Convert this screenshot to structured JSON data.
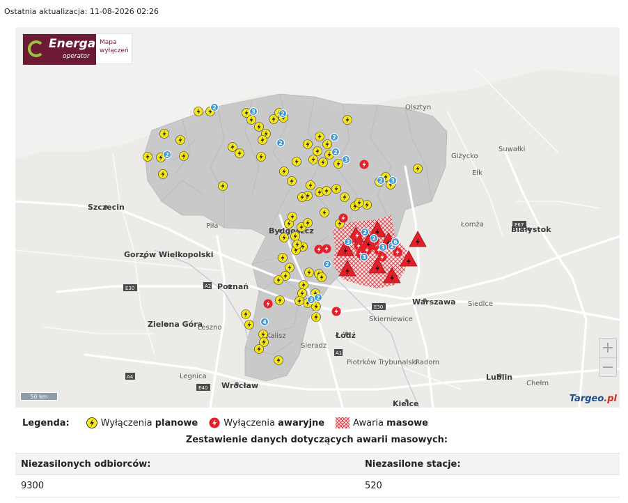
{
  "header": {
    "update_label": "Ostatnia aktualizacja:",
    "update_value": "11-08-2026 02:26"
  },
  "logo": {
    "brand": "Energa",
    "brand_sub": "operator",
    "title_line1": "Mapa",
    "title_line2": "wyłączeń"
  },
  "map": {
    "scale_label": "50 km",
    "attribution": "Targeo",
    "attribution_suffix": ".pl",
    "zoom_in": "+",
    "zoom_out": "−",
    "cities": [
      {
        "name": "Szczecin",
        "bold": true
      },
      {
        "name": "Bydgoszcz",
        "bold": true
      },
      {
        "name": "Poznań",
        "bold": true
      },
      {
        "name": "Zielona Góra",
        "bold": true
      },
      {
        "name": "Gorzów Wielkopolski",
        "bold": true
      },
      {
        "name": "Łódź",
        "bold": true
      },
      {
        "name": "Warszawa",
        "bold": true
      },
      {
        "name": "Białystok",
        "bold": true
      },
      {
        "name": "Lublin",
        "bold": true
      },
      {
        "name": "Kielce",
        "bold": true
      },
      {
        "name": "Wrocław",
        "bold": true
      },
      {
        "name": "Radom",
        "bold": false
      },
      {
        "name": "Olsztyn",
        "bold": false
      },
      {
        "name": "Łomża",
        "bold": false
      },
      {
        "name": "Siedlce",
        "bold": false
      },
      {
        "name": "Legnica",
        "bold": false
      },
      {
        "name": "Piła",
        "bold": false
      },
      {
        "name": "Suwałki",
        "bold": false
      },
      {
        "name": "Ełk",
        "bold": false
      },
      {
        "name": "Giżycko",
        "bold": false
      },
      {
        "name": "Chełm",
        "bold": false
      },
      {
        "name": "Leszno",
        "bold": false
      },
      {
        "name": "Sieradz",
        "bold": false
      },
      {
        "name": "Skierniewice",
        "bold": false
      },
      {
        "name": "Piotrków Trybunalski",
        "bold": false
      },
      {
        "name": "Kalisz",
        "bold": false
      }
    ],
    "marker_counts": {
      "planned": 78,
      "emergency": 14,
      "mass": 9,
      "clusters": [
        "2",
        "3",
        "2",
        "2",
        "2",
        "2",
        "3",
        "2",
        "3",
        "2",
        "4",
        "3",
        "3",
        "2",
        "2",
        "2",
        "3",
        "6",
        "2",
        "3",
        "2"
      ]
    }
  },
  "legend": {
    "title": "Legenda:",
    "planned_prefix": "Wyłączenia",
    "planned_bold": "planowe",
    "emergency_prefix": "Wyłączenia",
    "emergency_bold": "awaryjne",
    "mass_prefix": "Awaria",
    "mass_bold": "masowe",
    "colors": {
      "planned": "#f6e51b",
      "emergency": "#e3202a",
      "mass": "#e3202a",
      "cluster": "#3d97d3"
    }
  },
  "summary": {
    "title": "Zestawienie danych dotyczących awarii masowych:",
    "columns": [
      "Niezasilonych odbiorców:",
      "Niezasilone stacje:"
    ],
    "values": [
      "9300",
      "520"
    ]
  }
}
